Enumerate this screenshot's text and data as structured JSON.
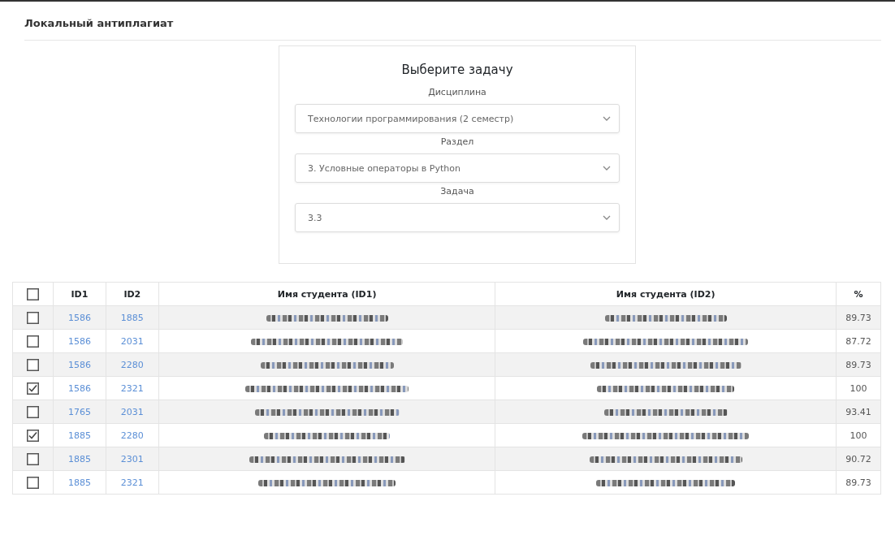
{
  "page_title": "Локальный антиплагиат",
  "task_form": {
    "title": "Выберите задачу",
    "fields": [
      {
        "label": "Дисциплина",
        "value": "Технологии программирования (2 семестр)"
      },
      {
        "label": "Раздел",
        "value": "3. Условные операторы в Python"
      },
      {
        "label": "Задача",
        "value": "3.3"
      }
    ]
  },
  "table": {
    "select_all": {
      "checked": false
    },
    "columns": [
      "ID1",
      "ID2",
      "Имя студента (ID1)",
      "Имя студента (ID2)",
      "%"
    ],
    "rows": [
      {
        "checked": false,
        "id1": "1586",
        "id2": "1885",
        "percent": "89.73"
      },
      {
        "checked": false,
        "id1": "1586",
        "id2": "2031",
        "percent": "87.72"
      },
      {
        "checked": false,
        "id1": "1586",
        "id2": "2280",
        "percent": "89.73"
      },
      {
        "checked": true,
        "id1": "1586",
        "id2": "2321",
        "percent": "100"
      },
      {
        "checked": false,
        "id1": "1765",
        "id2": "2031",
        "percent": "93.41"
      },
      {
        "checked": true,
        "id1": "1885",
        "id2": "2280",
        "percent": "100"
      },
      {
        "checked": false,
        "id1": "1885",
        "id2": "2301",
        "percent": "90.72"
      },
      {
        "checked": false,
        "id1": "1885",
        "id2": "2321",
        "percent": "89.73"
      }
    ]
  }
}
